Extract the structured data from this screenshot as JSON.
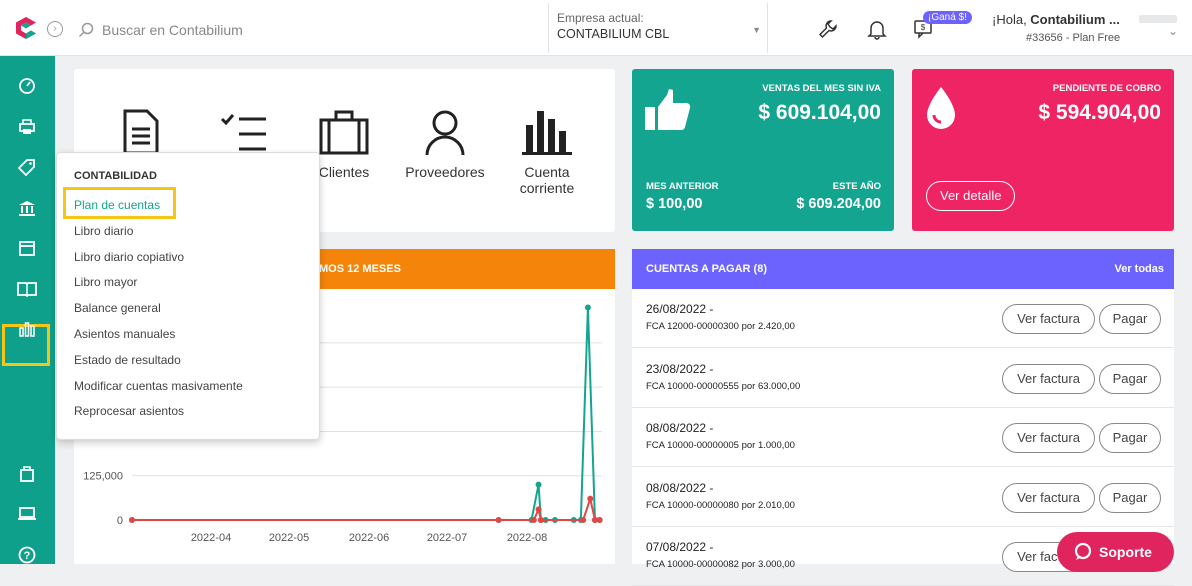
{
  "header": {
    "search_placeholder": "Buscar en Contabilium",
    "company_label": "Empresa actual:",
    "company_value": "CONTABILIUM CBL",
    "promo_badge": "¡Ganá $!",
    "greeting_prefix": "¡Hola, ",
    "greeting_name": "Contabilium ...",
    "plan": "#33656 - Plan Free",
    "icons": [
      "wrench-icon",
      "bell-icon",
      "referral-icon"
    ]
  },
  "sidebar": {
    "items": [
      "dashboard-icon",
      "printer-icon",
      "tag-icon",
      "bank-icon",
      "box-icon",
      "book-icon",
      "bar-chart-icon",
      "bag-icon",
      "laptop-icon",
      "help-icon"
    ],
    "active": "book-icon"
  },
  "quick_access": [
    {
      "icon": "document-icon",
      "label": ""
    },
    {
      "icon": "checklist-icon",
      "label": ""
    },
    {
      "icon": "briefcase-icon",
      "label": "Clientes"
    },
    {
      "icon": "person-icon",
      "label": "Proveedores"
    },
    {
      "icon": "bar-chart-icon",
      "label": "Cuenta corriente"
    }
  ],
  "sales_card": {
    "title": "VENTAS DEL MES SIN IVA",
    "value": "$ 609.104,00",
    "prev_label": "MES ANTERIOR",
    "prev_value": "$ 100,00",
    "year_label": "ESTE AÑO",
    "year_value": "$ 609.204,00",
    "color": "#13a58f"
  },
  "pending_card": {
    "title": "PENDIENTE DE COBRO",
    "value": "$ 594.904,00",
    "button": "Ver detalle",
    "color": "#ef2464"
  },
  "chart_panel": {
    "title_fragment": "MOS 12 MESES",
    "color": "#f5850a"
  },
  "chart_data": {
    "type": "line",
    "x": [
      "2022-04",
      "2022-05",
      "2022-06",
      "2022-07",
      "2022-08"
    ],
    "y_ticks": [
      "0",
      "125,000"
    ],
    "ylim": [
      0,
      590000
    ],
    "series": [
      {
        "color": "#13a58f",
        "points": [
          [
            0,
            0
          ],
          [
            0.78,
            0
          ],
          [
            0.85,
            0
          ],
          [
            0.865,
            100000
          ],
          [
            0.87,
            0
          ],
          [
            0.88,
            0
          ],
          [
            0.9,
            0
          ],
          [
            0.94,
            0
          ],
          [
            0.955,
            0
          ],
          [
            0.97,
            600000
          ],
          [
            0.985,
            0
          ],
          [
            0.995,
            0
          ]
        ]
      },
      {
        "color": "#e04848",
        "points": [
          [
            0,
            0
          ],
          [
            0.78,
            0
          ],
          [
            0.855,
            0
          ],
          [
            0.865,
            30000
          ],
          [
            0.87,
            0
          ],
          [
            0.96,
            0
          ],
          [
            0.975,
            60000
          ],
          [
            0.985,
            0
          ],
          [
            0.995,
            0
          ]
        ]
      }
    ]
  },
  "payables": {
    "title": "CUENTAS A PAGAR (8)",
    "link": "Ver todas",
    "view_label": "Ver factura",
    "pay_label": "Pagar",
    "rows": [
      {
        "date": "26/08/2022 -",
        "desc": "FCA 12000-00000300 por 2.420,00"
      },
      {
        "date": "23/08/2022 -",
        "desc": "FCA 10000-00000555 por 63.000,00"
      },
      {
        "date": "08/08/2022 -",
        "desc": "FCA 10000-00000005 por 1.000,00"
      },
      {
        "date": "08/08/2022 -",
        "desc": "FCA 10000-00000080 por 2.010,00"
      },
      {
        "date": "07/08/2022 -",
        "desc": "FCA 10000-00000082 por 3.000,00"
      }
    ],
    "color": "#6c63ff"
  },
  "dropdown": {
    "title": "CONTABILIDAD",
    "items": [
      "Plan de cuentas",
      "Libro diario",
      "Libro diario copiativo",
      "Libro mayor",
      "Balance general",
      "Asientos manuales",
      "Estado de resultado",
      "Modificar cuentas masivamente",
      "Reprocesar asientos"
    ],
    "highlighted": "Plan de cuentas"
  },
  "support_button": "Soporte"
}
